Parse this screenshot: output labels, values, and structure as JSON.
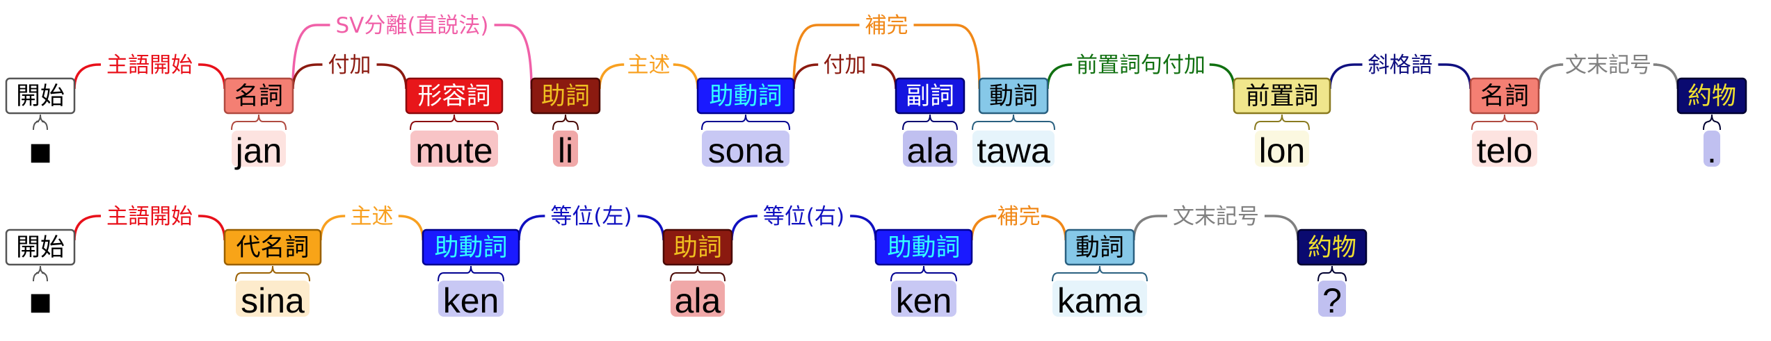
{
  "sentences": [
    {
      "tokens": [
        {
          "pos": "開始",
          "word": "■",
          "fill": "#ffffff",
          "stroke": "#555555",
          "text_color": "#000000",
          "word_bg": "none"
        },
        {
          "pos": "名詞",
          "word": "jan",
          "fill": "#f47f73",
          "stroke": "#b04a40",
          "text_color": "#000000",
          "word_bg": "#fde3e0"
        },
        {
          "pos": "形容詞",
          "word": "mute",
          "fill": "#e8161a",
          "stroke": "#8b0a0c",
          "text_color": "#ffffff",
          "word_bg": "#f8c4c6"
        },
        {
          "pos": "助詞",
          "word": "li",
          "fill": "#8b1a10",
          "stroke": "#4a0a05",
          "text_color": "#f0c020",
          "word_bg": "#f0a8a8"
        },
        {
          "pos": "助動詞",
          "word": "sona",
          "fill": "#1a1aff",
          "stroke": "#000090",
          "text_color": "#33ffff",
          "word_bg": "#c8c8f4"
        },
        {
          "pos": "副詞",
          "word": "ala",
          "fill": "#1515e0",
          "stroke": "#000070",
          "text_color": "#ffffff",
          "word_bg": "#c0c0f0"
        },
        {
          "pos": "動詞",
          "word": "tawa",
          "fill": "#86c8e8",
          "stroke": "#2a6080",
          "text_color": "#000000",
          "word_bg": "#e6f4fb"
        },
        {
          "pos": "前置詞",
          "word": "lon",
          "fill": "#f0e68c",
          "stroke": "#8a7a20",
          "text_color": "#000000",
          "word_bg": "#fbf8e0"
        },
        {
          "pos": "名詞",
          "word": "telo",
          "fill": "#f47f73",
          "stroke": "#b04a40",
          "text_color": "#000000",
          "word_bg": "#fde3e0"
        },
        {
          "pos": "約物",
          "word": ".",
          "fill": "#0a0a70",
          "stroke": "#000030",
          "text_color": "#f0e030",
          "word_bg": "#c0c0f0"
        }
      ],
      "edges": [
        {
          "from": 0,
          "to": 1,
          "label": "主語開始",
          "color": "#e8101a"
        },
        {
          "from": 1,
          "to": 3,
          "label": "SV分離(直説法)",
          "color": "#f060a8"
        },
        {
          "from": 1,
          "to": 2,
          "label": "付加",
          "color": "#8b1a10"
        },
        {
          "from": 3,
          "to": 4,
          "label": "主述",
          "color": "#f8a020"
        },
        {
          "from": 4,
          "to": 6,
          "label": "補完",
          "color": "#f08818"
        },
        {
          "from": 4,
          "to": 5,
          "label": "付加",
          "color": "#8b1a10"
        },
        {
          "from": 6,
          "to": 7,
          "label": "前置詞句付加",
          "color": "#107010"
        },
        {
          "from": 7,
          "to": 8,
          "label": "斜格語",
          "color": "#101080"
        },
        {
          "from": 8,
          "to": 9,
          "label": "文末記号",
          "color": "#808080"
        }
      ]
    },
    {
      "tokens": [
        {
          "pos": "開始",
          "word": "■",
          "fill": "#ffffff",
          "stroke": "#555555",
          "text_color": "#000000",
          "word_bg": "none"
        },
        {
          "pos": "代名詞",
          "word": "sina",
          "fill": "#f8a418",
          "stroke": "#9a6000",
          "text_color": "#000000",
          "word_bg": "#fdebcc"
        },
        {
          "pos": "助動詞",
          "word": "ken",
          "fill": "#1a1aff",
          "stroke": "#000090",
          "text_color": "#33ffff",
          "word_bg": "#c8c8f4"
        },
        {
          "pos": "助詞",
          "word": "ala",
          "fill": "#8b1a10",
          "stroke": "#4a0a05",
          "text_color": "#f0c020",
          "word_bg": "#f0a8a8"
        },
        {
          "pos": "助動詞",
          "word": "ken",
          "fill": "#1a1aff",
          "stroke": "#000090",
          "text_color": "#33ffff",
          "word_bg": "#c8c8f4"
        },
        {
          "pos": "動詞",
          "word": "kama",
          "fill": "#86c8e8",
          "stroke": "#2a6080",
          "text_color": "#000000",
          "word_bg": "#e6f4fb"
        },
        {
          "pos": "約物",
          "word": "?",
          "fill": "#0a0a70",
          "stroke": "#000030",
          "text_color": "#f0e030",
          "word_bg": "#c0c0f0"
        }
      ],
      "edges": [
        {
          "from": 0,
          "to": 1,
          "label": "主語開始",
          "color": "#e8101a"
        },
        {
          "from": 1,
          "to": 2,
          "label": "主述",
          "color": "#f8a020"
        },
        {
          "from": 2,
          "to": 3,
          "label": "等位(左)",
          "color": "#1010c0"
        },
        {
          "from": 3,
          "to": 4,
          "label": "等位(右)",
          "color": "#1010c0"
        },
        {
          "from": 4,
          "to": 5,
          "label": "補完",
          "color": "#f08818"
        },
        {
          "from": 5,
          "to": 6,
          "label": "文末記号",
          "color": "#808080"
        }
      ]
    }
  ]
}
